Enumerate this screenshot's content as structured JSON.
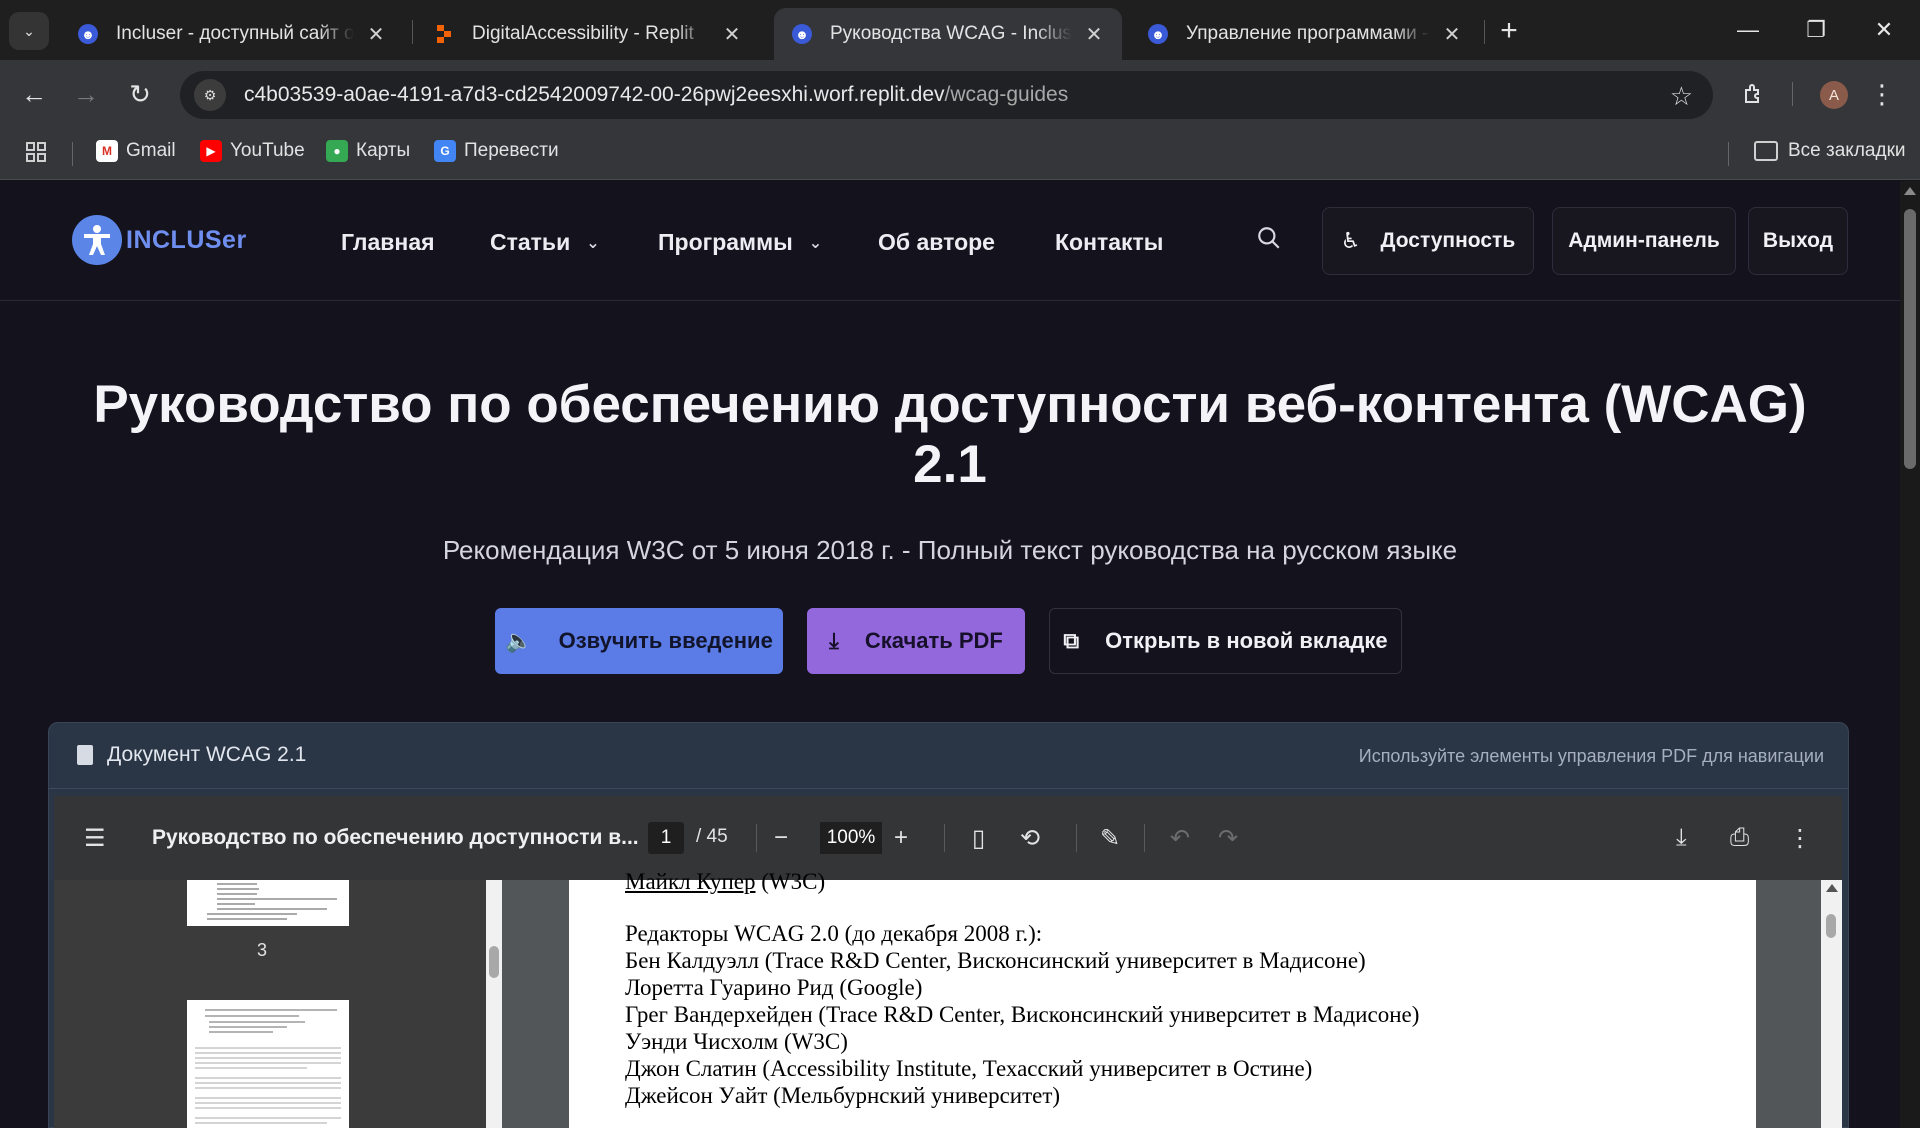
{
  "browser": {
    "tabs": [
      {
        "title": "Incluser - доступный сайт о доступности",
        "active": false
      },
      {
        "title": "DigitalAccessibility - Replit",
        "active": false
      },
      {
        "title": "Руководства WCAG - Incluser",
        "active": true
      },
      {
        "title": "Управление программами - Admin",
        "active": false
      }
    ],
    "url_host": "c4b03539-a0ae-4191-a7d3-cd2542009742-00-26pwj2eesxhi.worf.replit.dev",
    "url_path": "/wcag-guides",
    "profile_initial": "A",
    "bookmarks": [
      {
        "label": "Gmail",
        "icon": "gmail-icon"
      },
      {
        "label": "YouTube",
        "icon": "youtube-icon"
      },
      {
        "label": "Карты",
        "icon": "maps-icon"
      },
      {
        "label": "Перевести",
        "icon": "translate-icon"
      }
    ],
    "all_bookmarks": "Все закладки"
  },
  "site": {
    "logo_text": "INCLUSer",
    "nav": {
      "home": "Главная",
      "articles": "Статьи",
      "programs": "Программы",
      "about": "Об авторе",
      "contacts": "Контакты"
    },
    "accessibility_button": "Доступность",
    "admin_button": "Админ-панель",
    "logout_button": "Выход"
  },
  "hero": {
    "title": "Руководство по обеспечению доступности веб-контента (WCAG) 2.1",
    "subtitle": "Рекомендация W3C от 5 июня 2018 г. - Полный текст руководства на русском языке",
    "speak_button": "Озвучить введение",
    "download_button": "Скачать PDF",
    "open_button": "Открыть в новой вкладке"
  },
  "document": {
    "header_title": "Документ WCAG 2.1",
    "hint": "Используйте элементы управления PDF для навигации",
    "viewer_title": "Руководство по обеспечению доступности в...",
    "current_page": "1",
    "total_pages": "/ 45",
    "zoom": "100%",
    "thumbnail_label": "3",
    "page_lines": {
      "top_partial_name": "Майкл Купер",
      "top_partial_org": " (W3C)",
      "editors_heading": "Редакторы WCAG 2.0 (до декабря 2008 г.):",
      "editor1": "Бен Калдуэлл (Trace R&D Center, Висконсинский университет в Мадисоне)",
      "editor2": "Лоретта Гуарино Рид (Google)",
      "editor3": "Грег Вандерхейден (Trace R&D Center, Висконсинский университет в Мадисоне)",
      "editor4": "Уэнди Чисхолм (W3C)",
      "editor5": "Джон Слатин (Accessibility Institute, Техасский университет в Остине)",
      "editor6": "Джейсон Уайт (Мельбурнский университет)"
    }
  },
  "colors": {
    "page_bg": "#14121d",
    "primary_button": "#5b7be6",
    "pdf_button": "#9468dd",
    "logo_blue": "#6f8ff0"
  }
}
